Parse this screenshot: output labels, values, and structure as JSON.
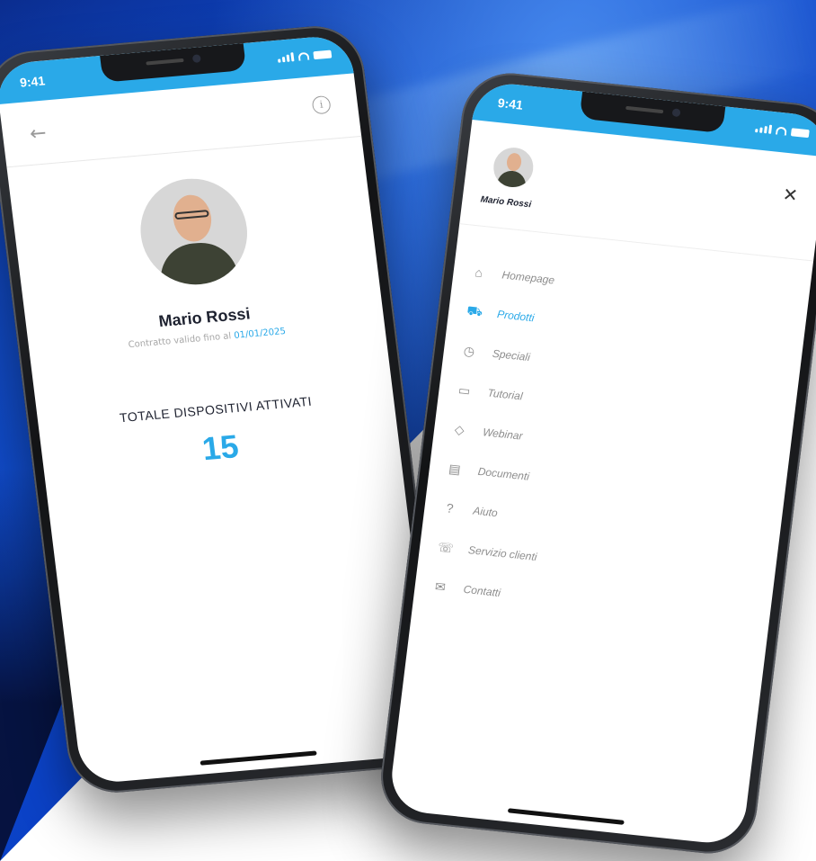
{
  "status_bar": {
    "time": "9:41"
  },
  "profile_screen": {
    "name": "Mario Rossi",
    "contract_prefix": "Contratto valido fino al",
    "contract_date": "01/01/2025",
    "total_label": "TOTALE DISPOSITIVI ATTIVATI",
    "total_value": "15"
  },
  "menu_screen": {
    "user_name": "Mario Rossi",
    "items": [
      {
        "label": "Homepage",
        "icon": "home-icon",
        "active": false
      },
      {
        "label": "Prodotti",
        "icon": "cart-icon",
        "active": true
      },
      {
        "label": "Speciali",
        "icon": "clock-icon",
        "active": false
      },
      {
        "label": "Tutorial",
        "icon": "video-icon",
        "active": false
      },
      {
        "label": "Webinar",
        "icon": "chat-icon",
        "active": false
      },
      {
        "label": "Documenti",
        "icon": "document-icon",
        "active": false
      },
      {
        "label": "Aiuto",
        "icon": "help-icon",
        "active": false
      },
      {
        "label": "Servizio clienti",
        "icon": "support-icon",
        "active": false
      },
      {
        "label": "Contatti",
        "icon": "contact-icon",
        "active": false
      }
    ]
  },
  "colors": {
    "accent": "#2aa9e8",
    "text_dark": "#1e2230",
    "text_muted": "#8d8d8d",
    "background_blue": "#0d4bd6"
  }
}
